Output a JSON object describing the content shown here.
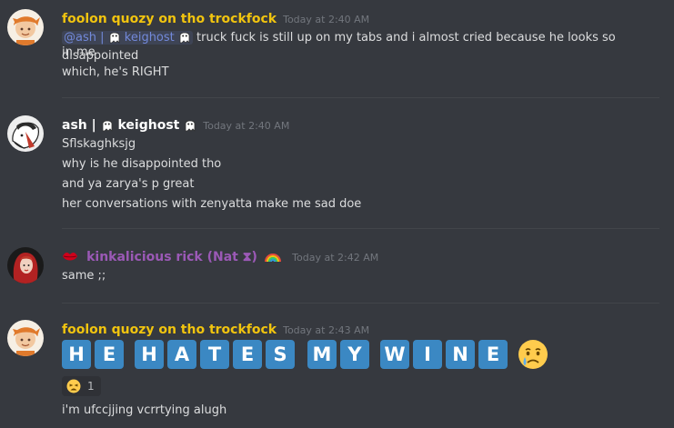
{
  "colors": {
    "background": "#36393f",
    "text": "#dcddde",
    "timestamp": "#72767d",
    "mention": "#7289da",
    "user_orange": "#f1c40f",
    "user_purple": "#9b59b6",
    "tile_blue": "#3b88c3"
  },
  "messages": [
    {
      "author": "foolon quozy on tho trockfock",
      "timestamp": "Today at 2:40 AM",
      "mention_prefix": "@ash | ",
      "mention_suffix": "keighost",
      "line1_text": "truck fuck is still up on my tabs and i almost cried because he looks so disappointed",
      "line1_wrap": "in me",
      "line2": "which, he's RIGHT"
    },
    {
      "author_prefix": "ash | ",
      "author_suffix": "keighost",
      "timestamp": "Today at 2:40 AM",
      "lines": [
        "Sflskaghksjg",
        "why is he disappointed tho",
        "and ya zarya's p great",
        "her conversations with zenyatta make me sad doe"
      ]
    },
    {
      "author": "kinkalicious rick (Nat ⧗)",
      "timestamp": "Today at 2:42 AM",
      "lines": [
        "same ;;"
      ]
    },
    {
      "author": "foolon quozy on tho trockfock",
      "timestamp": "Today at 2:43 AM",
      "tiles": [
        "H",
        "E",
        "H",
        "A",
        "T",
        "E",
        "S",
        "M",
        "Y",
        "W",
        "I",
        "N",
        "E"
      ],
      "emoji": "crying-face-icon",
      "reaction_count": "1",
      "last_line": "i'm ufccjjing vcrrtying alugh"
    }
  ]
}
